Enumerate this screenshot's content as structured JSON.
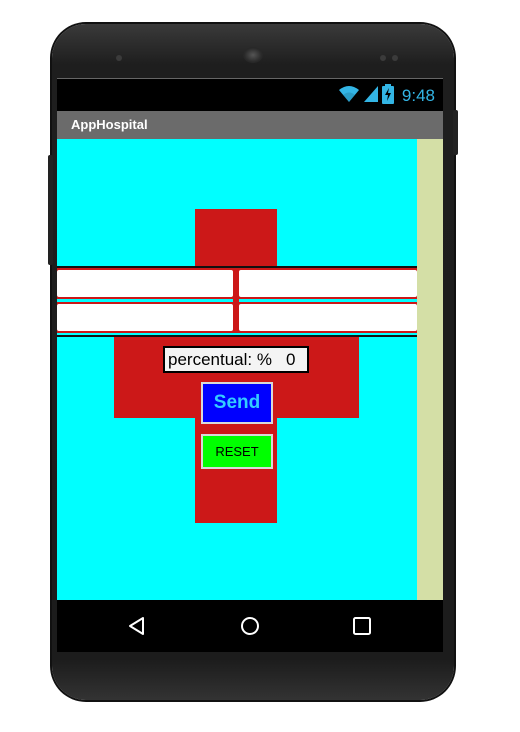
{
  "status_bar": {
    "time": "9:48",
    "wifi_icon": "wifi-icon",
    "signal_icon": "cell-signal-icon",
    "battery_icon": "battery-charging-icon"
  },
  "app": {
    "title": "AppHospital"
  },
  "form": {
    "field_1": {
      "value": "",
      "placeholder": ""
    },
    "field_2": {
      "value": "",
      "placeholder": ""
    },
    "field_3": {
      "value": "",
      "placeholder": ""
    },
    "field_4": {
      "value": "",
      "placeholder": ""
    },
    "percent_label": "percentual: %",
    "percent_value": "0",
    "send_label": "Send",
    "reset_label": "RESET"
  },
  "navigation": {
    "back_icon": "back-triangle-icon",
    "home_icon": "home-circle-icon",
    "recents_icon": "recents-square-icon"
  },
  "colors": {
    "background": "#00ffff",
    "cross": "#cc1818",
    "send_button": "#0000ff",
    "send_text": "#33ccff",
    "reset_button": "#00ff00",
    "status_accent": "#33b5e5",
    "side_strip": "#d4dfa6"
  }
}
